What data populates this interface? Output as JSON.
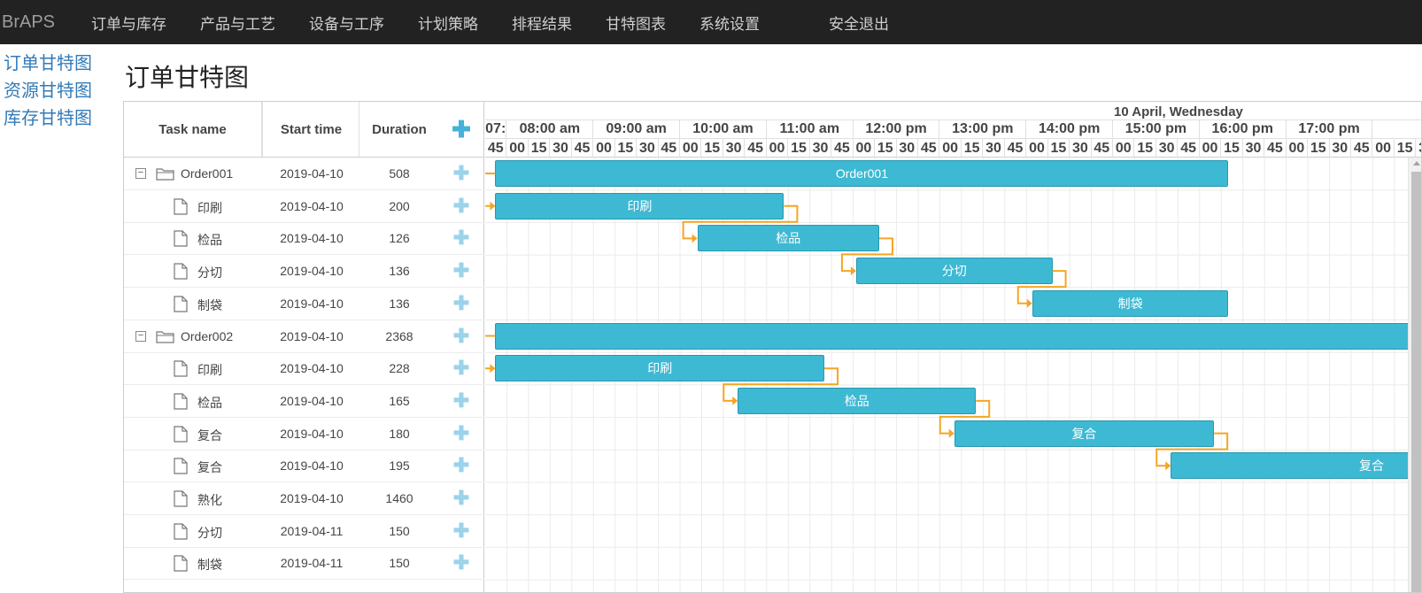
{
  "brand": "BrAPS",
  "nav": [
    "订单与库存",
    "产品与工艺",
    "设备与工序",
    "计划策略",
    "排程结果",
    "甘特图表",
    "系统设置"
  ],
  "logout": "安全退出",
  "sidebar": [
    "订单甘特图",
    "资源甘特图",
    "库存甘特图"
  ],
  "page_title": "订单甘特图",
  "grid": {
    "headers": {
      "name": "Task name",
      "start": "Start time",
      "duration": "Duration"
    },
    "rows": [
      {
        "name": "Order001",
        "start": "2019-04-10",
        "duration": "508",
        "parent": true
      },
      {
        "name": "印刷",
        "start": "2019-04-10",
        "duration": "200",
        "parent": false
      },
      {
        "name": "检品",
        "start": "2019-04-10",
        "duration": "126",
        "parent": false
      },
      {
        "name": "分切",
        "start": "2019-04-10",
        "duration": "136",
        "parent": false
      },
      {
        "name": "制袋",
        "start": "2019-04-10",
        "duration": "136",
        "parent": false
      },
      {
        "name": "Order002",
        "start": "2019-04-10",
        "duration": "2368",
        "parent": true
      },
      {
        "name": "印刷",
        "start": "2019-04-10",
        "duration": "228",
        "parent": false
      },
      {
        "name": "检品",
        "start": "2019-04-10",
        "duration": "165",
        "parent": false
      },
      {
        "name": "复合",
        "start": "2019-04-10",
        "duration": "180",
        "parent": false
      },
      {
        "name": "复合",
        "start": "2019-04-10",
        "duration": "195",
        "parent": false
      },
      {
        "name": "熟化",
        "start": "2019-04-10",
        "duration": "1460",
        "parent": false
      },
      {
        "name": "分切",
        "start": "2019-04-11",
        "duration": "150",
        "parent": false
      },
      {
        "name": "制袋",
        "start": "2019-04-11",
        "duration": "150",
        "parent": false
      }
    ]
  },
  "timeline": {
    "day_label": "10 April, Wednesday",
    "hours": [
      "07:",
      "08:00 am",
      "09:00 am",
      "10:00 am",
      "11:00 am",
      "12:00 pm",
      "13:00 pm",
      "14:00 pm",
      "15:00 pm",
      "16:00 pm",
      "17:00 pm"
    ],
    "minutes": [
      "45",
      "00",
      "15",
      "30",
      "45"
    ]
  },
  "bars": [
    {
      "row": 0,
      "label": "Order001",
      "start": "07:52",
      "end": "16:20"
    },
    {
      "row": 1,
      "label": "印刷",
      "start": "07:52",
      "end": "11:12"
    },
    {
      "row": 2,
      "label": "检品",
      "start": "10:12",
      "end": "12:18"
    },
    {
      "row": 3,
      "label": "分切",
      "start": "12:02",
      "end": "14:18"
    },
    {
      "row": 4,
      "label": "制袋",
      "start": "14:04",
      "end": "16:20"
    },
    {
      "row": 5,
      "label": "",
      "start": "07:52",
      "end": ""
    },
    {
      "row": 6,
      "label": "印刷",
      "start": "07:52",
      "end": "11:40"
    },
    {
      "row": 7,
      "label": "检品",
      "start": "10:40",
      "end": "13:25"
    },
    {
      "row": 8,
      "label": "复合",
      "start": "13:10",
      "end": "16:10"
    },
    {
      "row": 9,
      "label": "复合",
      "start": "15:40",
      "end": ""
    }
  ],
  "colors": {
    "bar": "#3db9d3",
    "link": "#f5a623",
    "nav_bg": "#222222",
    "link_text": "#337ab7"
  }
}
